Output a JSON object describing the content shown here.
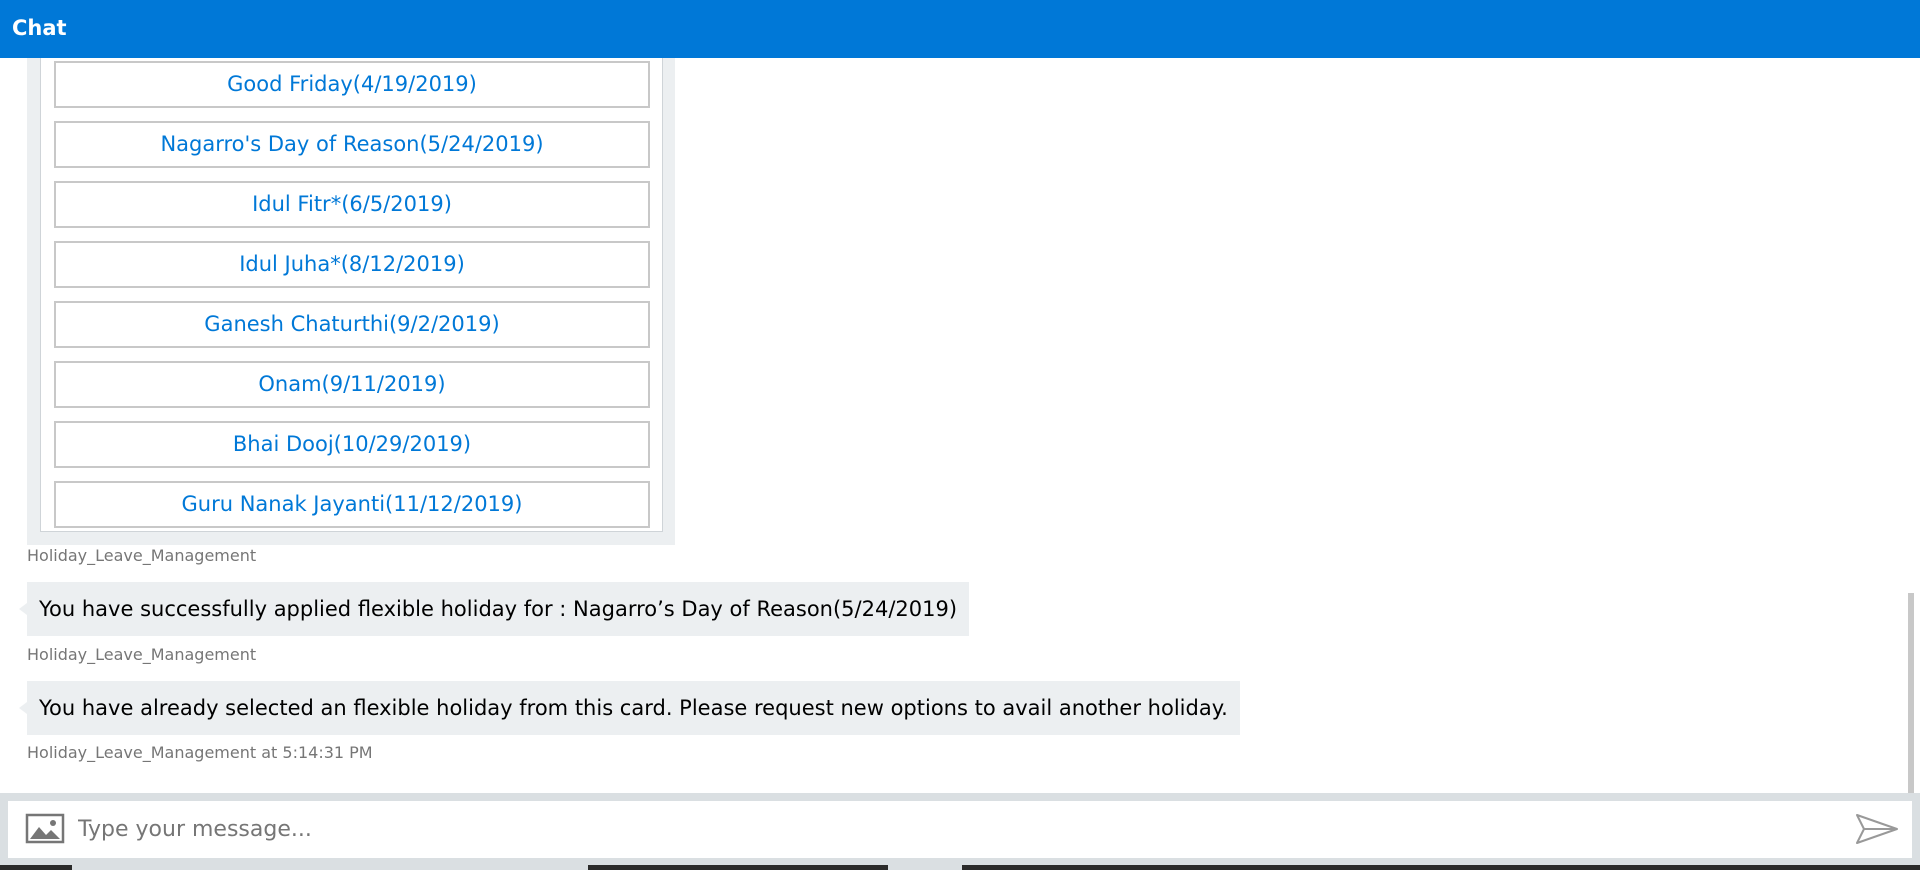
{
  "header": {
    "title": "Chat"
  },
  "card": {
    "buttons": [
      {
        "label": "Good Friday(4/19/2019)"
      },
      {
        "label": "Nagarro's Day of Reason(5/24/2019)"
      },
      {
        "label": "Idul Fitr*(6/5/2019)"
      },
      {
        "label": "Idul Juha*(8/12/2019)"
      },
      {
        "label": "Ganesh Chaturthi(9/2/2019)"
      },
      {
        "label": "Onam(9/11/2019)"
      },
      {
        "label": "Bhai Dooj(10/29/2019)"
      },
      {
        "label": "Guru Nanak Jayanti(11/12/2019)"
      }
    ],
    "sender": "Holiday_Leave_Management"
  },
  "messages": [
    {
      "text": "You have successfully applied flexible holiday for : Nagarro’s Day of Reason(5/24/2019)",
      "sender": "Holiday_Leave_Management"
    },
    {
      "text": "You have already selected an flexible holiday from this card. Please request new options to avail another holiday.",
      "sender": "Holiday_Leave_Management at 5:14:31 PM"
    }
  ],
  "input": {
    "placeholder": "Type your message...",
    "upload_icon": "image-upload-icon",
    "send_icon": "send-icon"
  },
  "colors": {
    "accent": "#0078d7",
    "bubble_bg": "#eceff1",
    "sender_text": "#767676"
  }
}
